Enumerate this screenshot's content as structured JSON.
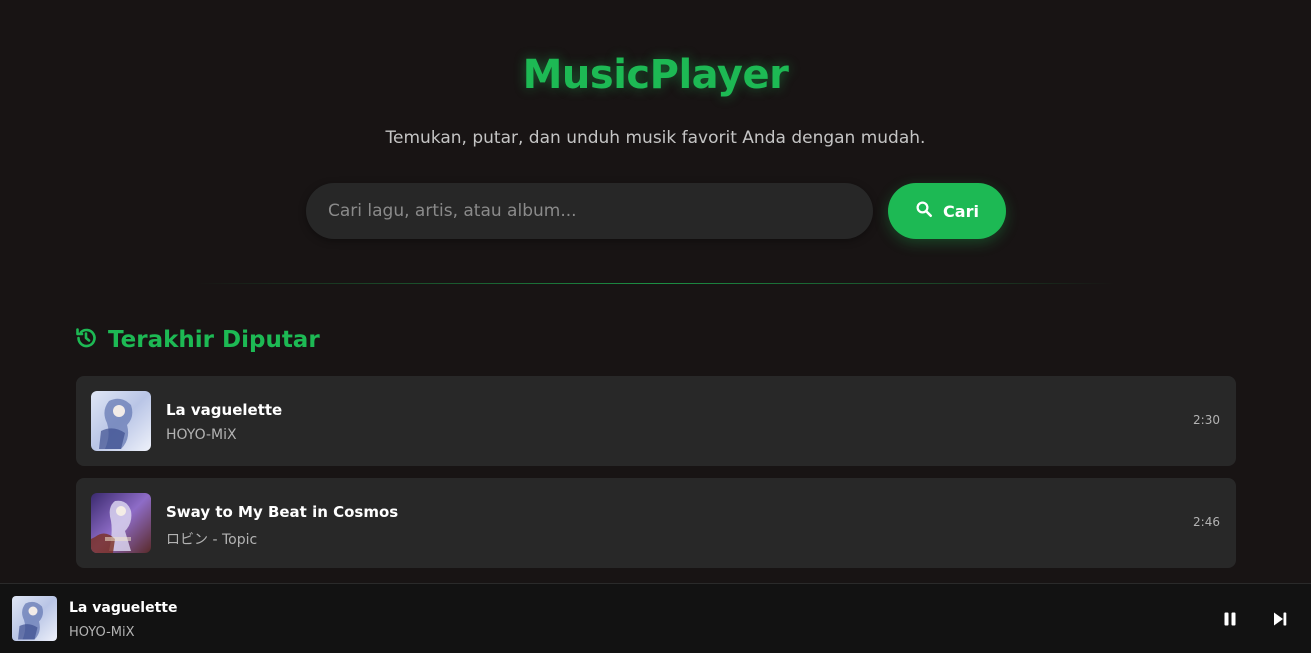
{
  "header": {
    "title": "MusicPlayer",
    "subtitle": "Temukan, putar, dan unduh musik favorit Anda dengan mudah."
  },
  "search": {
    "placeholder": "Cari lagu, artis, atau album...",
    "value": "",
    "button_label": "Cari",
    "button_icon": "search-icon"
  },
  "recent": {
    "icon": "history-icon",
    "title": "Terakhir Diputar",
    "tracks": [
      {
        "title": "La vaguelette",
        "artist": "HOYO-MiX",
        "duration": "2:30",
        "cover_icon": "album-cover"
      },
      {
        "title": "Sway to My Beat in Cosmos",
        "artist": "ロビン - Topic",
        "duration": "2:46",
        "cover_icon": "album-cover"
      }
    ]
  },
  "player": {
    "title": "La vaguelette",
    "artist": "HOYO-MiX",
    "controls": [
      "pause-icon",
      "skip-next-icon"
    ]
  },
  "colors": {
    "accent": "#1db954",
    "background": "#181414",
    "card": "#282828",
    "player_bar": "#121212"
  }
}
